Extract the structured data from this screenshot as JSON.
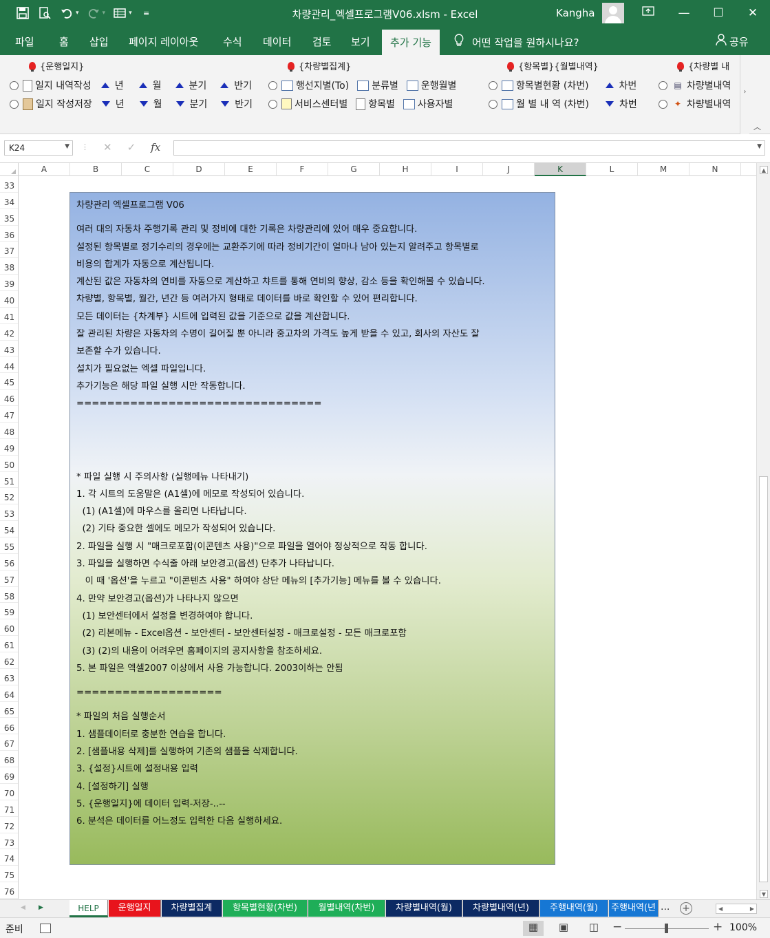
{
  "window": {
    "title": "차량관리_엑셀프로그램V06.xlsm  -  Excel",
    "user": "Kangha",
    "qat_icons": [
      "save-icon",
      "print-preview-icon",
      "undo-icon",
      "redo-icon",
      "form-icon",
      "customize-icon"
    ],
    "controls": [
      "minimize-icon",
      "maximize-icon",
      "close-icon"
    ]
  },
  "ribbon_tabs": [
    "파일",
    "홈",
    "삽입",
    "페이지 레이아웃",
    "수식",
    "데이터",
    "검토",
    "보기",
    "추가 기능"
  ],
  "tell_me": "어떤 작업을 원하시나요?",
  "share": "공유",
  "addin": {
    "groups": [
      {
        "header": "{운행일지}",
        "row1": {
          "label": "일지 내역작성",
          "year": "년",
          "month": "월",
          "quarter": "분기",
          "half": "반기"
        },
        "row2": {
          "label": "일지 작성저장",
          "year": "년",
          "month": "월",
          "quarter": "분기",
          "half": "반기"
        }
      },
      {
        "header": "{차량별집계}",
        "row1": [
          "행선지별(To)",
          "분류별",
          "운행월별"
        ],
        "row2": [
          "서비스센터별",
          "항목별",
          "사용자별"
        ]
      },
      {
        "header": "{항목별}{월별내역}",
        "row1": {
          "label": "항목별현황 (차번)",
          "arrow": "차번"
        },
        "row2": {
          "label": "월 별 내 역 (차번)",
          "arrow": "차번"
        }
      },
      {
        "header": "{차량별 내",
        "row1": "차량별내역",
        "row2": "차량별내역"
      }
    ]
  },
  "formula_bar": {
    "name_box": "K24",
    "formula": ""
  },
  "columns": [
    "A",
    "B",
    "C",
    "D",
    "E",
    "F",
    "G",
    "H",
    "I",
    "J",
    "K",
    "L",
    "M",
    "N"
  ],
  "selected_column": "K",
  "rows": [
    "33",
    "34",
    "35",
    "36",
    "37",
    "38",
    "39",
    "40",
    "41",
    "42",
    "43",
    "44",
    "45",
    "46",
    "47",
    "48",
    "49",
    "50",
    "51",
    "52",
    "53",
    "54",
    "55",
    "56",
    "57",
    "58",
    "59",
    "60",
    "61",
    "62",
    "63",
    "64",
    "65",
    "66",
    "67",
    "68",
    "69",
    "70",
    "71",
    "72",
    "73",
    "74",
    "75",
    "76"
  ],
  "help_box": {
    "title": "차량관리 엑셀프로그램 V06",
    "intro": [
      "여러 대의 자동차 주행기록 관리 및 정비에 대한 기록은 차량관리에 있어 매우 중요합니다.",
      "설정된 항목별로 정기수리의 경우에는 교환주기에 따라 정비기간이 얼마나 남아 있는지 알려주고 항목별로",
      "비용의 합계가 자동으로 계산됩니다.",
      "계산된 값은 자동차의 연비를 자동으로 계산하고 챠트를 통해 연비의 향상, 감소 등을 확인해볼 수 있습니다.",
      "차량별, 항목별, 월간, 년간 등 여러가지 형태로 데이터를 바로 확인할 수 있어 편리합니다.",
      "모든 데이터는 {차계부} 시트에 입력된 값을 기준으로 값을 계산합니다.",
      "잘 관리된 차량은 자동차의 수명이 길어질 뿐 아니라 중고차의 가격도 높게 받을 수 있고, 회사의 자산도 잘",
      "보존할 수가 있습니다.",
      "설치가 필요없는 엑셀 파일입니다.",
      "추가기능은 해당 파일 실행 시만 작동합니다.",
      "================================"
    ],
    "notes": [
      "* 파일 실행 시 주의사항 (실행메뉴 나타내기)",
      "1. 각 시트의 도움말은 (A1셀)에 메모로 작성되어 있습니다.",
      "  (1) (A1셀)에 마우스를 올리면 나타납니다.",
      "  (2) 기타 중요한 셀에도 메모가 작성되어 있습니다.",
      "2. 파일을 실행 시 \"매크로포함(이콘텐츠 사용)\"으로 파일을 열어야 정상적으로 작동 합니다.",
      "3. 파일을 실행하면 수식줄 아래 보안경고(옵션) 단추가 나타납니다.",
      "   이 때 '옵션'을 누르고 \"이콘텐츠 사용\" 하여야 상단 메뉴의 [추가기능] 메뉴를 볼 수 있습니다.",
      "4. 만약 보안경고(옵션)가 나타나지 않으면",
      "  (1) 보안센터에서 설정을 변경하여야 합니다.",
      "  (2) 리본메뉴 - Excel옵션 - 보안센터 - 보안센터설정 - 매크로설정 - 모든 매크로포함",
      "  (3) (2)의 내용이 어려우면 홈페이지의 공지사항을 참조하세요.",
      "5. 본 파일은 엑셀2007 이상에서 사용 가능합니다. 2003이하는 안됨"
    ],
    "divider2": "===================",
    "steps": [
      "* 파일의 처음 실행순서",
      "1. 샘플데이터로 충분한 연습을 합니다.",
      "2. [샘플내용 삭제]를 실행하여 기존의 샘플을 삭제합니다.",
      "3. {설정}시트에 설정내용 입력",
      "4. [설정하기] 실행",
      "5. {운행일지}에 데이터 입력-저장-..--",
      "6. 분석은 데이터를 어느정도 입력한 다음 실행하세요."
    ]
  },
  "sheet_tabs": [
    {
      "label": "HELP",
      "color": "#ffffff"
    },
    {
      "label": "운행일지",
      "color": "#e8141c"
    },
    {
      "label": "차량별집계",
      "color": "#0c2a63"
    },
    {
      "label": "항목별현황(차번)",
      "color": "#1fae58"
    },
    {
      "label": "월별내역(차번)",
      "color": "#1fae58"
    },
    {
      "label": "차량별내역(월)",
      "color": "#0c2a63"
    },
    {
      "label": "차량별내역(년)",
      "color": "#0c2a63"
    },
    {
      "label": "주행내역(월)",
      "color": "#1677d4"
    },
    {
      "label": "주행내역(년",
      "color": "#1677d4"
    }
  ],
  "tab_overflow": "...",
  "status": {
    "ready": "준비",
    "zoom": "100%"
  }
}
